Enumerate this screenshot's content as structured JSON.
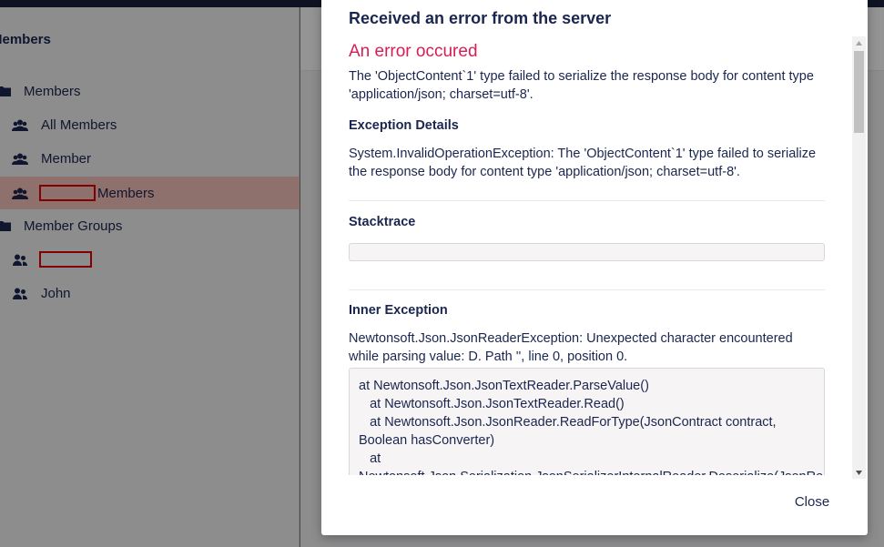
{
  "sidebar": {
    "title": "Members",
    "items": [
      {
        "label": "Members",
        "icon": "folder-icon"
      },
      {
        "label": "All Members",
        "icon": "members-icon"
      },
      {
        "label": "Member",
        "icon": "members-icon"
      },
      {
        "label": "Members",
        "icon": "members-icon",
        "redacted_prefix": true
      },
      {
        "label": "Member Groups",
        "icon": "folder-icon"
      },
      {
        "label": "",
        "icon": "member-group-icon",
        "redacted": true
      },
      {
        "label": "John",
        "icon": "member-group-icon"
      }
    ]
  },
  "modal": {
    "title": "Received an error from the server",
    "error_heading": "An error occured",
    "message": "The 'ObjectContent`1' type failed to serialize the response body for content type 'application/json; charset=utf-8'.",
    "exception_details_label": "Exception Details",
    "exception_details": "System.InvalidOperationException: The 'ObjectContent`1' type failed to serialize the response body for content type 'application/json; charset=utf-8'.",
    "stacktrace_label": "Stacktrace",
    "inner_exception_label": "Inner Exception",
    "inner_exception": "Newtonsoft.Json.JsonReaderException: Unexpected character encountered while parsing value: D. Path '', line 0, position 0.",
    "inner_stacktrace": [
      "at Newtonsoft.Json.JsonTextReader.ParseValue()",
      "   at Newtonsoft.Json.JsonTextReader.Read()",
      "   at Newtonsoft.Json.JsonReader.ReadForType(JsonContract contract,",
      "Boolean hasConverter)",
      "   at",
      "Newtonsoft.Json.Serialization.JsonSerializerInternalReader.Deserialize(JsonReader"
    ],
    "close_label": "Close"
  },
  "colors": {
    "brand_dark": "#1b264f",
    "error_pink": "#d42054",
    "active_row": "#f5c1bc",
    "top_bar": "#1b1f3a"
  }
}
